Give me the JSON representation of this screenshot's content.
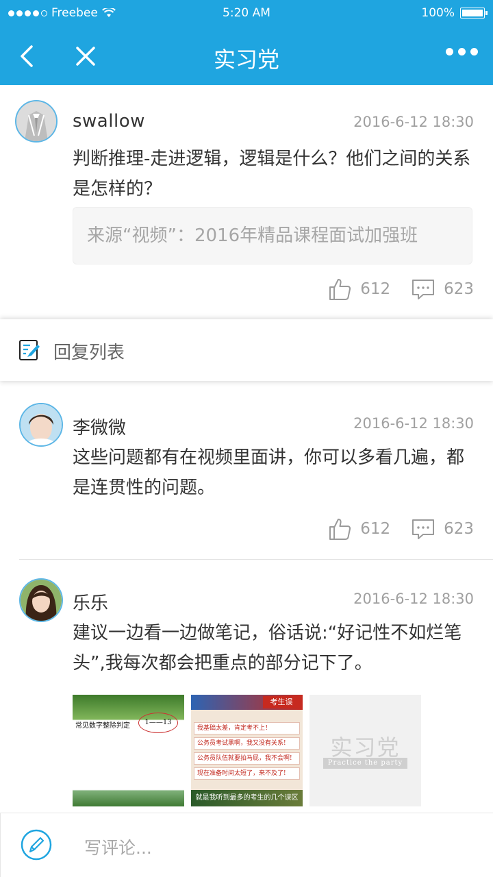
{
  "status_bar": {
    "carrier": "Freebee",
    "time": "5:20 AM",
    "battery": "100%"
  },
  "nav": {
    "title": "实习党"
  },
  "post": {
    "author": "swallow",
    "time": "2016-6-12 18:30",
    "content": "判断推理-走进逻辑，逻辑是什么？他们之间的关系是怎样的？",
    "source": "来源“视频”：2016年精品课程面试加强班",
    "likes": "612",
    "comments": "623"
  },
  "section": {
    "label": "回复列表"
  },
  "replies": [
    {
      "author": "李微微",
      "time": "2016-6-12 18:30",
      "content": "这些问题都有在视频里面讲，你可以多看几遍，都是连贯性的问题。",
      "likes": "612",
      "comments": "623"
    },
    {
      "author": "乐乐",
      "time": "2016-6-12 18:30",
      "content": "建议一边看一边做笔记，俗话说:“好记性不如烂笔头”,我每次都会把重点的部分记下了。"
    }
  ],
  "thumbs": {
    "t1_text": "常见数字整除判定",
    "t1_oval": "1——13",
    "t2_header": "考生误",
    "t2_rows": [
      "我基础太差，肯定考不上！",
      "公务员考试黑啊，我又没有关系!",
      "公务员队伍就要拍马屁，我不会啊!",
      "现在准备时间太短了，来不及了!"
    ],
    "t2_bottom": "就是我听到最多的考生的几个误区",
    "t3_watermark": "实习党",
    "t3_sub": "Practice the party"
  },
  "comment_bar": {
    "placeholder": "写评论..."
  },
  "colors": {
    "brand": "#1fa5e0",
    "avatar_border": "#5cb6e6"
  }
}
